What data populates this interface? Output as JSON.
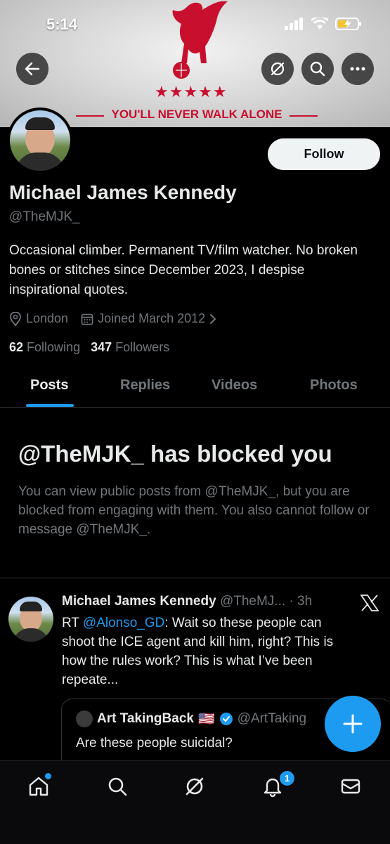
{
  "status_bar": {
    "time": "5:14"
  },
  "banner": {
    "slogan": "YOU'LL NEVER WALK ALONE",
    "stars": "★★★★★"
  },
  "profile": {
    "follow_label": "Follow",
    "name": "Michael James Kennedy",
    "handle": "@TheMJK_",
    "bio": "Occasional climber. Permanent TV/film watcher. No broken bones or stitches since December 2023, I despise inspirational quotes.",
    "location": "London",
    "joined": "Joined March 2012",
    "following_count": "62",
    "following_label": "Following",
    "followers_count": "347",
    "followers_label": "Followers"
  },
  "tabs": [
    {
      "label": "Posts",
      "active": true
    },
    {
      "label": "Replies"
    },
    {
      "label": "Videos"
    },
    {
      "label": "Photos"
    }
  ],
  "blocked": {
    "title": "@TheMJK_ has blocked you",
    "message": "You can view public posts from @TheMJK_, but you are blocked from engaging with them. You also cannot follow or message @TheMJK_."
  },
  "tweet": {
    "author_name": "Michael James Kennedy",
    "author_handle": "@TheMJ...",
    "time": "· 3h",
    "rt_prefix": "RT",
    "mention": "@Alonso_GD",
    "text": ": Wait so these people can shoot the ICE agent and kill him, right? This is how the rules work? This is what I’ve been repeate...",
    "quote": {
      "author_name": "Art TakingBack",
      "flag": "🇺🇸",
      "author_handle": "@ArtTaking",
      "text": "Are these people suicidal?"
    }
  },
  "bottom_nav": {
    "notifications_badge": "1"
  },
  "colors": {
    "accent": "#1d9bf0",
    "banner_red": "#c8102e",
    "muted": "#71767b"
  }
}
